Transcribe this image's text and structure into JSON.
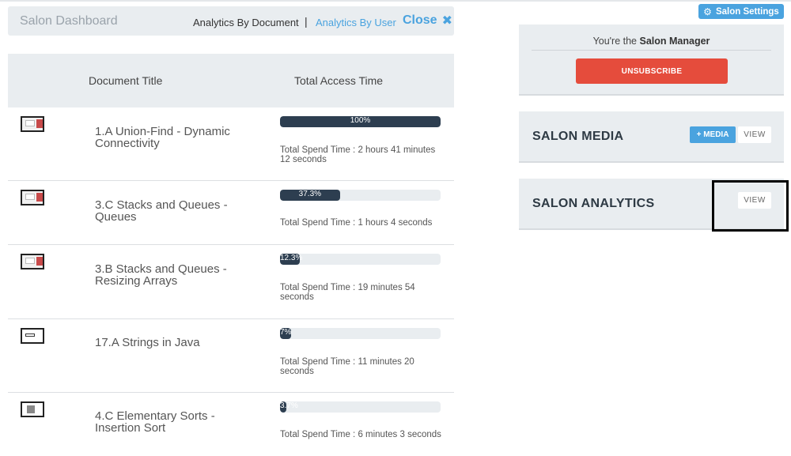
{
  "header": {
    "title": "Salon Dashboard",
    "tab_document": "Analytics By Document",
    "separator": "|",
    "tab_user": "Analytics By User",
    "close_label": "Close",
    "close_icon": "✖"
  },
  "table": {
    "columns": [
      "Document Title",
      "Total Access Time"
    ],
    "rows": [
      {
        "title": "1.A Union-Find - Dynamic Connectivity",
        "percent_label": "100%",
        "percent": 100,
        "spend": "Total Spend Time : 2 hours 41 minutes 12 seconds"
      },
      {
        "title": "3.C Stacks and Queues - Queues",
        "percent_label": "37.3%",
        "percent": 37.3,
        "spend": "Total Spend Time : 1 hours 4 seconds"
      },
      {
        "title": "3.B Stacks and Queues - Resizing Arrays",
        "percent_label": "12.3%",
        "percent": 12.3,
        "spend": "Total Spend Time : 19 minutes 54 seconds"
      },
      {
        "title": "17.A Strings in Java",
        "percent_label": "7%",
        "percent": 7,
        "spend": "Total Spend Time : 11 minutes 20 seconds"
      },
      {
        "title": "4.C Elementary Sorts - Insertion Sort",
        "percent_label": "3.7%",
        "percent": 3.7,
        "spend": "Total Spend Time : 6 minutes 3 seconds"
      }
    ]
  },
  "sidebar": {
    "settings_label": "Salon Settings",
    "settings_icon": "gear-icon",
    "manager_prefix": "You're the",
    "manager_role": "Salon Manager",
    "unsubscribe_label": "UNSUBSCRIBE",
    "media_title": "SALON MEDIA",
    "add_media_label": "+ MEDIA",
    "media_view_label": "VIEW",
    "analytics_title": "SALON ANALYTICS",
    "analytics_view_label": "VIEW"
  },
  "colors": {
    "accent": "#4aa3df",
    "danger": "#e54c3c",
    "bar_fill": "#2d3e50",
    "panel_bg": "#e9edf0"
  }
}
